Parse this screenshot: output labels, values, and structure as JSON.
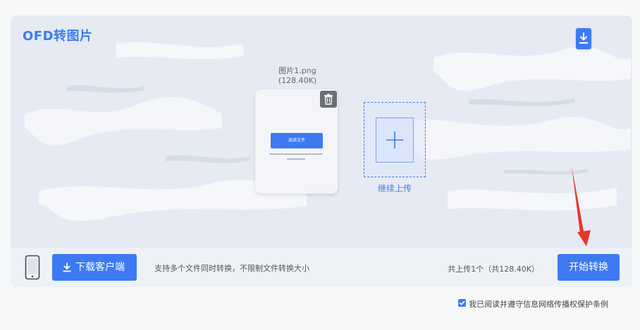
{
  "title": "OFD转图片",
  "file": {
    "name": "图片1.png",
    "size": "(128.40K)",
    "thumb_button": "选择文件"
  },
  "add_more_label": "继续上传",
  "bottom": {
    "client_button": "下载客户端",
    "support_text": "支持多个文件同时转换，不限制文件转换大小",
    "count_text": "共上传1个（共128.40K）",
    "start_button": "开始转换"
  },
  "agreement": {
    "checked": true,
    "label": "我已阅读并遵守信息网络传播权保护条例"
  },
  "icons": {
    "top_download": "download-icon",
    "trash": "trash-icon",
    "add": "plus-icon",
    "phone": "phone-icon",
    "client_download": "download-icon",
    "checkbox": "checkmark-icon"
  },
  "colors": {
    "accent": "#3d7af2",
    "background": "#e6ebf3",
    "annotation_arrow": "#e8352e"
  }
}
